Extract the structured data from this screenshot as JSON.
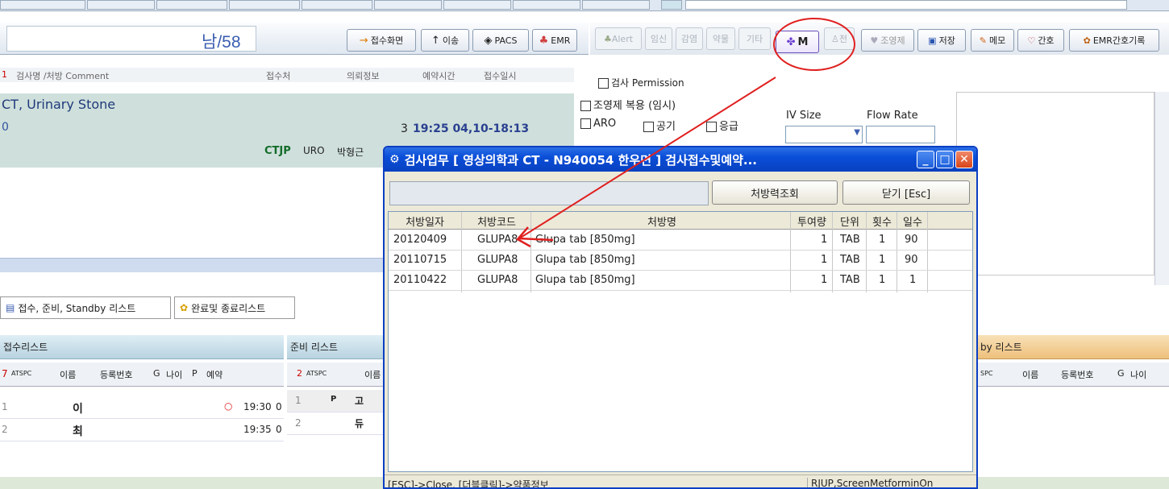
{
  "patient": {
    "name_age": "남/58"
  },
  "patient_buttons": [
    {
      "label": "접수화면",
      "icon": "→"
    },
    {
      "label": "이송",
      "icon": "↑"
    },
    {
      "label": "PACS",
      "icon": "◈"
    },
    {
      "label": "EMR",
      "icon": "♣"
    }
  ],
  "toolbar": {
    "alert": "Alert",
    "disabled": [
      "임신",
      "감염",
      "약물",
      "기타"
    ],
    "m_button": "M",
    "jeon": "전",
    "contrast": "조영제",
    "save": "저장",
    "memo": "메모",
    "nurse": "간호",
    "emr_nursing": "EMR간호기록"
  },
  "order_header": [
    "검사명 /처방 Comment",
    "접수처",
    "의뢰정보",
    "예약시간",
    "접수일시"
  ],
  "order": {
    "name": "CT, Urinary Stone",
    "left_code": "0",
    "time": "19:25 04,10-18:13",
    "time_prefix": "3",
    "code": "CTJP",
    "dept": "URO",
    "doctor": "박형근"
  },
  "options": {
    "permission": "검사 Permission",
    "contrast_oral": "조영제 복용 (임시)",
    "aro": "ARO",
    "air": "공기",
    "emergency": "응급",
    "iv_size": "IV Size",
    "flow_rate": "Flow Rate"
  },
  "tabs": [
    "접수, 준비, Standby 리스트",
    "완료및 종료리스트"
  ],
  "lists": {
    "reception": {
      "title": "접수리스트",
      "count": "7",
      "cols": [
        "이름",
        "등록번호",
        "G",
        "나이",
        "P",
        "예약"
      ],
      "rows": [
        {
          "no": "1",
          "name": "이",
          "mark": "○",
          "time": "19:30",
          "tail": "0"
        },
        {
          "no": "2",
          "name": "최",
          "mark": "",
          "time": "19:35",
          "tail": "0"
        }
      ]
    },
    "prepare": {
      "title": "준비 리스트",
      "count": "2",
      "col": "이름",
      "rows": [
        {
          "no": "1",
          "flag": "P",
          "name": "고"
        },
        {
          "no": "2",
          "flag": "",
          "name": "듀"
        }
      ]
    },
    "standby": {
      "title": "by 리스트",
      "cols": [
        "이름",
        "등록번호",
        "G",
        "나이"
      ]
    }
  },
  "dialog": {
    "title": "검사업무 [ 영상의학과 CT - N940054 한우면 ] 검사접수및예약...",
    "btn_history": "처방력조회",
    "btn_close": "닫기 [Esc]",
    "columns": [
      "처방일자",
      "처방코드",
      "처방명",
      "투여량",
      "단위",
      "횟수",
      "일수"
    ],
    "rows": [
      [
        "20120409",
        "GLUPA8",
        "Glupa tab [850mg]",
        "1",
        "TAB",
        "1",
        "90"
      ],
      [
        "20110715",
        "GLUPA8",
        "Glupa tab [850mg]",
        "1",
        "TAB",
        "1",
        "90"
      ],
      [
        "20110422",
        "GLUPA8",
        "Glupa tab [850mg]",
        "1",
        "TAB",
        "1",
        "1"
      ]
    ],
    "status_left": "[ESC]->Close,   [더블클릭]->약품정보",
    "status_right": "RJUP,ScreenMetforminOn"
  },
  "colors": {
    "accent_red": "#e02020",
    "title_blue": "#0a4ed8",
    "order_green": "#cfe0dc"
  }
}
